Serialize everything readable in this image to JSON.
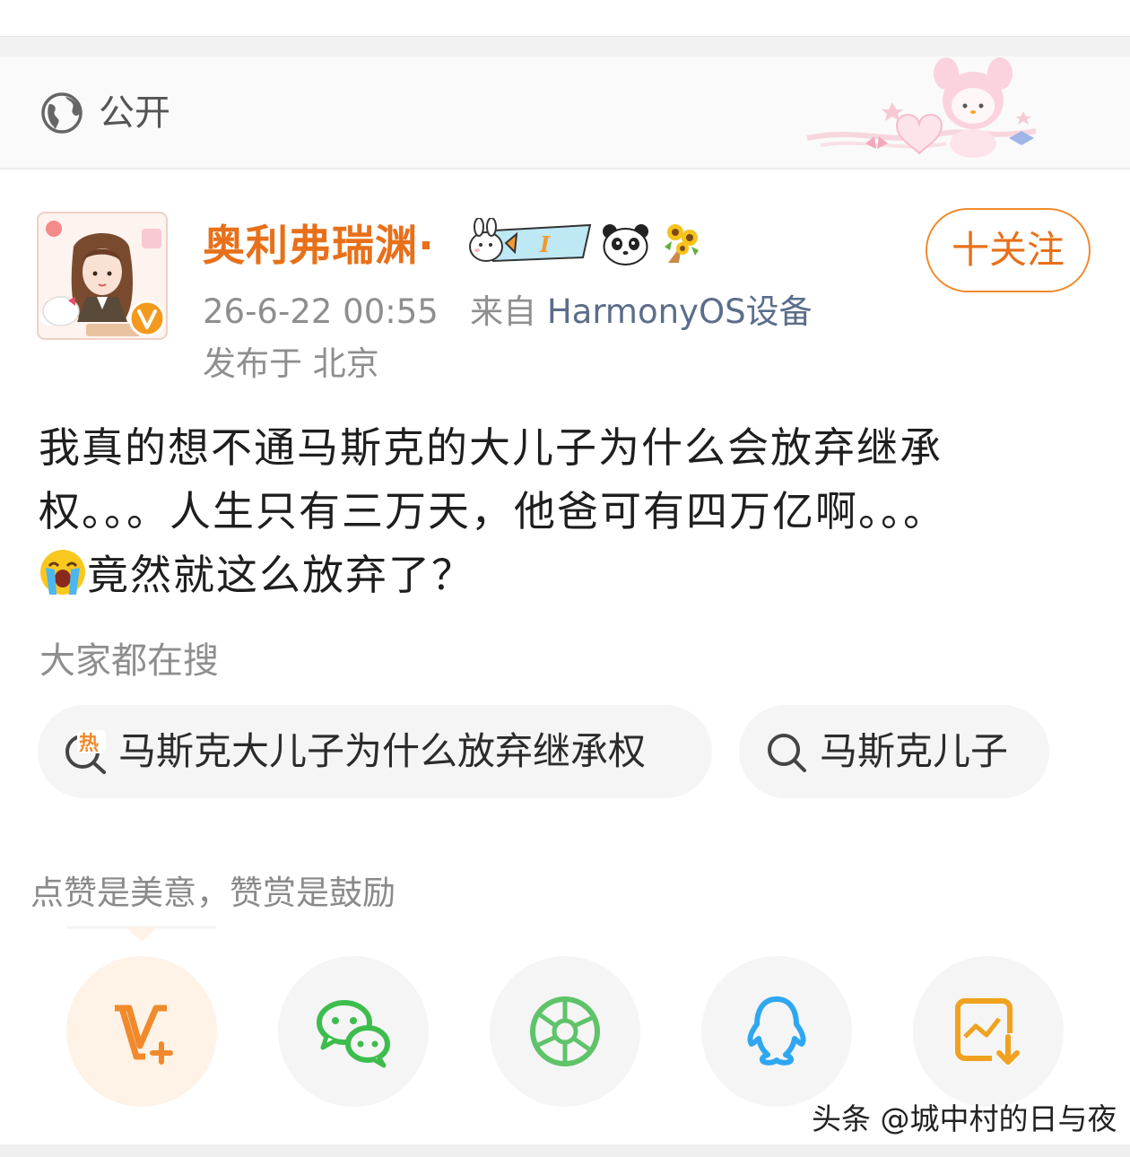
{
  "visibility": {
    "label": "公开",
    "icon": "globe-icon"
  },
  "post": {
    "author": {
      "name": "奥利弗瑞渊·",
      "verified_badge": "V"
    },
    "follow_label": "十关注",
    "time": "26-6-22 00:55",
    "source_prefix": "来自",
    "source": "HarmonyOS设备",
    "location": "发布于 北京",
    "text_line1": "我真的想不通马斯克的大儿子为什么会放弃继承",
    "text_line2": "权。。。人生只有三万天，他爸可有四万亿啊。。。",
    "text_line3": "竟然就这么放弃了？"
  },
  "search": {
    "heading": "大家都在搜",
    "chips": [
      {
        "text": "马斯克大儿子为什么放弃继承权",
        "icon": "hot-search-icon"
      },
      {
        "text": "马斯克儿子",
        "icon": "search-icon"
      }
    ]
  },
  "reward_tip": "点赞是美意，赞赏是鼓励",
  "share": [
    {
      "icon": "v-plus-icon"
    },
    {
      "icon": "wechat-icon"
    },
    {
      "icon": "moments-icon"
    },
    {
      "icon": "qq-icon"
    },
    {
      "icon": "save-image-icon"
    }
  ],
  "watermark": "头条 @城中村的日与夜",
  "colors": {
    "accent": "#e8701a",
    "link": "#5b6d8a",
    "wechat": "#3dbd4e",
    "qq": "#2fa7f0"
  }
}
